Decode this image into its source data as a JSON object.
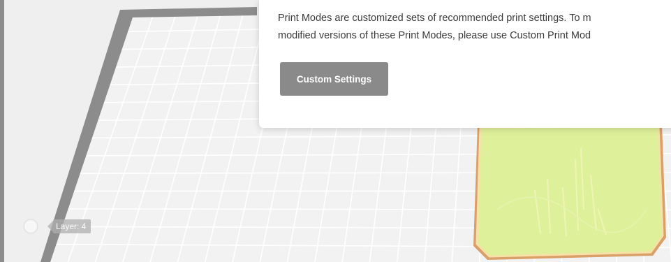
{
  "viewport": {
    "layer_indicator": {
      "label": "Layer: 4"
    }
  },
  "popup": {
    "description_line1": "Print Modes are customized sets of recommended print settings. To m",
    "description_line2": "modified versions of these Print Modes, please use Custom Print Mod",
    "custom_settings_button": "Custom Settings"
  },
  "colors": {
    "build_plate": "#f2f2f2",
    "grid_lines": "#ffffff",
    "plate_border": "#8c8c8c",
    "model_fill": "#dff09a",
    "model_edge": "#d9a06a",
    "button": "#8a8a8a"
  }
}
